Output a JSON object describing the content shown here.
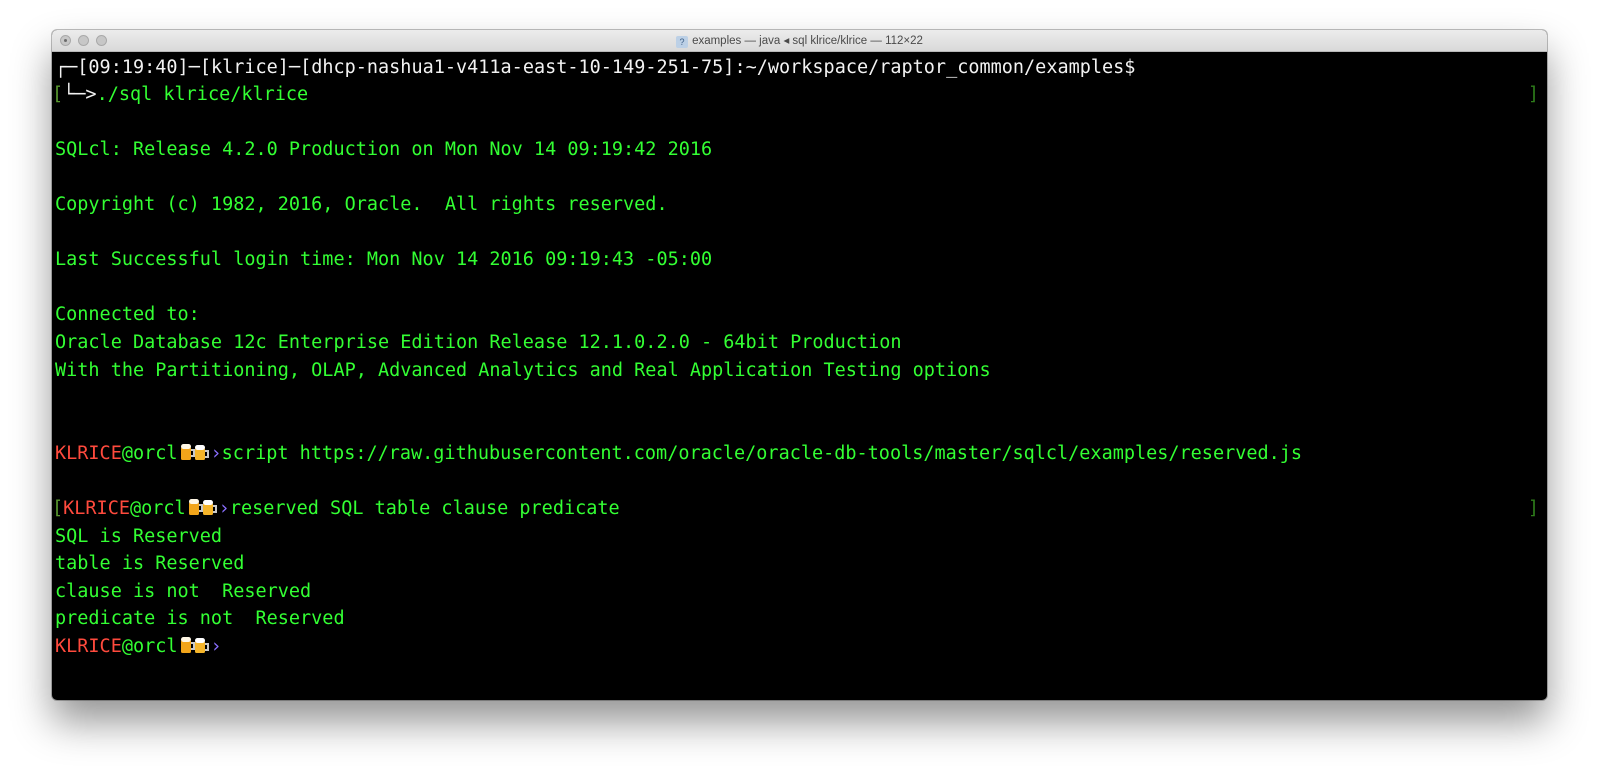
{
  "window": {
    "title": "examples — java ◂ sql klrice/klrice — 112×22"
  },
  "terminal": {
    "prompt": {
      "corner": "┌─",
      "time": "[09:19:40]",
      "sep1": "─",
      "user": "[klrice]",
      "sep2": "─",
      "host": "[dhcp-nashua1-v411a-east-10-149-251-75]",
      "path": ":~/workspace/raptor_common/examples$"
    },
    "command": {
      "bracket": "[",
      "arrow": "└─>",
      "text": "./sql klrice/klrice",
      "end_bracket": "]"
    },
    "banner": {
      "release": "SQLcl: Release 4.2.0 Production on Mon Nov 14 09:19:42 2016",
      "copyright": "Copyright (c) 1982, 2016, Oracle.  All rights reserved.",
      "last_login": "Last Successful login time: Mon Nov 14 2016 09:19:43 -05:00",
      "connected": "Connected to:",
      "database": "Oracle Database 12c Enterprise Edition Release 12.1.0.2.0 - 64bit Production",
      "options": "With the Partitioning, OLAP, Advanced Analytics and Real Application Testing options"
    },
    "sql_prompt": {
      "user": "KLRICE",
      "at_db": "@orcl",
      "chevron": "›",
      "beer_icon": "beer-mugs-icon"
    },
    "commands": {
      "script": "script https://raw.githubusercontent.com/oracle/oracle-db-tools/master/sqlcl/examples/reserved.js",
      "reserved_bracket": "[",
      "reserved": "reserved SQL table clause predicate",
      "reserved_end_bracket": "]"
    },
    "output": [
      "SQL is Reserved",
      "table is Reserved",
      "clause is not  Reserved",
      "predicate is not  Reserved"
    ]
  },
  "colors": {
    "background": "#000000",
    "text": "#33ff33",
    "prompt_user": "#ff4a3d",
    "prompt_chevron": "#8a6fff",
    "header_text": "#f2f2f2"
  }
}
